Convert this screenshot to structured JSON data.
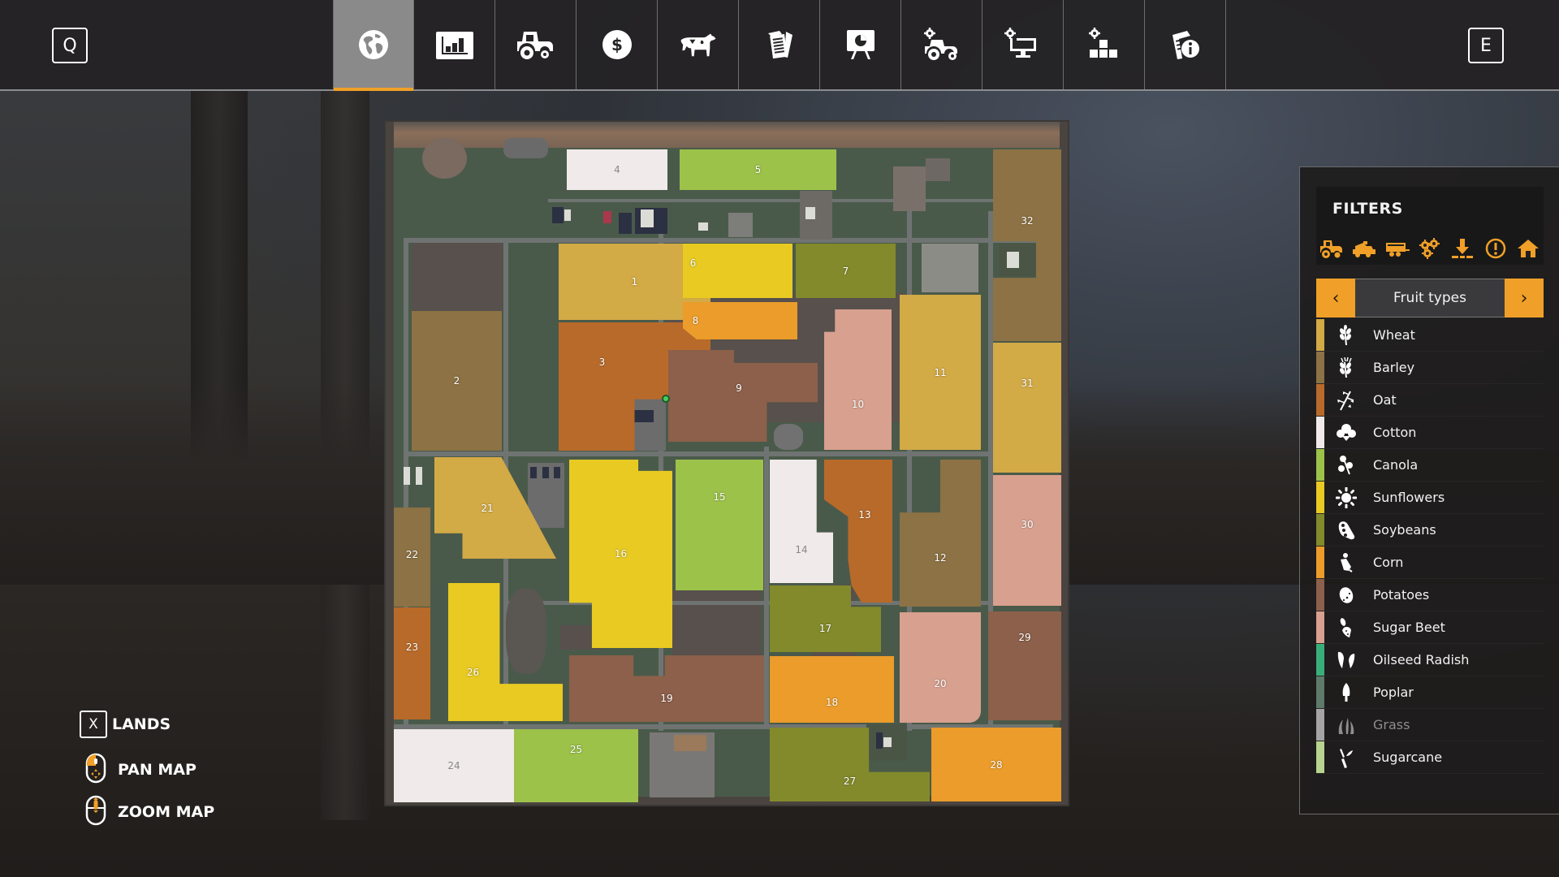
{
  "topbar": {
    "left_key": "Q",
    "right_key": "E",
    "tabs": [
      {
        "icon": "globe-icon",
        "name": "map",
        "active": true
      },
      {
        "icon": "chart-icon",
        "name": "statistics",
        "active": false
      },
      {
        "icon": "tractor-icon",
        "name": "vehicles",
        "active": false
      },
      {
        "icon": "dollar-coin-icon",
        "name": "finances",
        "active": false
      },
      {
        "icon": "cow-icon",
        "name": "animals",
        "active": false
      },
      {
        "icon": "contracts-icon",
        "name": "contracts",
        "active": false
      },
      {
        "icon": "presentation-board-icon",
        "name": "price-chart",
        "active": false
      },
      {
        "icon": "tractor-gear-icon",
        "name": "garage",
        "active": false
      },
      {
        "icon": "monitor-gear-icon",
        "name": "production",
        "active": false
      },
      {
        "icon": "blocks-gear-icon",
        "name": "general-settings",
        "active": false
      },
      {
        "icon": "document-info-icon",
        "name": "help",
        "active": false
      }
    ],
    "accent_color": "#f0a028"
  },
  "map": {
    "fields": [
      {
        "id": "1",
        "fruit": "Wheat"
      },
      {
        "id": "2",
        "fruit": "Barley"
      },
      {
        "id": "3",
        "fruit": "Oat"
      },
      {
        "id": "4",
        "fruit": "Cotton"
      },
      {
        "id": "5",
        "fruit": "Canola"
      },
      {
        "id": "6",
        "fruit": "Sunflowers"
      },
      {
        "id": "7",
        "fruit": "Soybeans"
      },
      {
        "id": "8",
        "fruit": "Corn"
      },
      {
        "id": "9",
        "fruit": "Potatoes"
      },
      {
        "id": "10",
        "fruit": "Sugar Beet"
      },
      {
        "id": "11",
        "fruit": "Wheat"
      },
      {
        "id": "12",
        "fruit": "Barley"
      },
      {
        "id": "13",
        "fruit": "Oat"
      },
      {
        "id": "14",
        "fruit": "Cotton"
      },
      {
        "id": "15",
        "fruit": "Canola"
      },
      {
        "id": "16",
        "fruit": "Sunflowers"
      },
      {
        "id": "17",
        "fruit": "Soybeans"
      },
      {
        "id": "18",
        "fruit": "Corn"
      },
      {
        "id": "19",
        "fruit": "Potatoes"
      },
      {
        "id": "20",
        "fruit": "Sugar Beet"
      },
      {
        "id": "21",
        "fruit": "Wheat"
      },
      {
        "id": "22",
        "fruit": "Barley"
      },
      {
        "id": "23",
        "fruit": "Oat"
      },
      {
        "id": "24",
        "fruit": "Cotton"
      },
      {
        "id": "25",
        "fruit": "Canola"
      },
      {
        "id": "26",
        "fruit": "Sunflowers"
      },
      {
        "id": "27",
        "fruit": "Soybeans"
      },
      {
        "id": "28",
        "fruit": "Corn"
      },
      {
        "id": "29",
        "fruit": "Potatoes"
      },
      {
        "id": "30",
        "fruit": "Sugar Beet"
      },
      {
        "id": "31",
        "fruit": "Wheat"
      },
      {
        "id": "32",
        "fruit": "Barley"
      }
    ]
  },
  "filters": {
    "title": "FILTERS",
    "icons": [
      "tractor-icon",
      "harvester-icon",
      "trailer-icon",
      "gears-icon",
      "unload-arrow-icon",
      "alert-circle-icon",
      "house-icon"
    ],
    "selector": {
      "label": "Fruit types",
      "prev": "‹",
      "next": "›"
    },
    "fruit_types": [
      {
        "name": "Wheat",
        "color": "#d2aa46",
        "icon": "wheat-icon",
        "enabled": true
      },
      {
        "name": "Barley",
        "color": "#8c7244",
        "icon": "barley-icon",
        "enabled": true
      },
      {
        "name": "Oat",
        "color": "#b86a2a",
        "icon": "oat-icon",
        "enabled": true
      },
      {
        "name": "Cotton",
        "color": "#f0eaea",
        "icon": "cotton-icon",
        "enabled": true
      },
      {
        "name": "Canola",
        "color": "#9cc24a",
        "icon": "canola-icon",
        "enabled": true
      },
      {
        "name": "Sunflowers",
        "color": "#e8ca22",
        "icon": "sunflower-icon",
        "enabled": true
      },
      {
        "name": "Soybeans",
        "color": "#828a2c",
        "icon": "soybean-icon",
        "enabled": true
      },
      {
        "name": "Corn",
        "color": "#eb9c2a",
        "icon": "corn-icon",
        "enabled": true
      },
      {
        "name": "Potatoes",
        "color": "#8c604a",
        "icon": "potato-icon",
        "enabled": true
      },
      {
        "name": "Sugar Beet",
        "color": "#d8a08e",
        "icon": "sugar-beet-icon",
        "enabled": true
      },
      {
        "name": "Oilseed Radish",
        "color": "#3aae7a",
        "icon": "oilseed-radish-icon",
        "enabled": true
      },
      {
        "name": "Poplar",
        "color": "#5e7a6a",
        "icon": "poplar-icon",
        "enabled": true
      },
      {
        "name": "Grass",
        "color": "#a4a4a4",
        "icon": "grass-icon",
        "enabled": false
      },
      {
        "name": "Sugarcane",
        "color": "#b8d490",
        "icon": "sugarcane-icon",
        "enabled": true
      }
    ]
  },
  "controls": {
    "lands": {
      "key": "X",
      "label": "LANDS"
    },
    "pan": {
      "label": "PAN MAP",
      "icon": "mouse-left-drag-icon"
    },
    "zoom": {
      "label": "ZOOM MAP",
      "icon": "mouse-wheel-icon"
    }
  }
}
